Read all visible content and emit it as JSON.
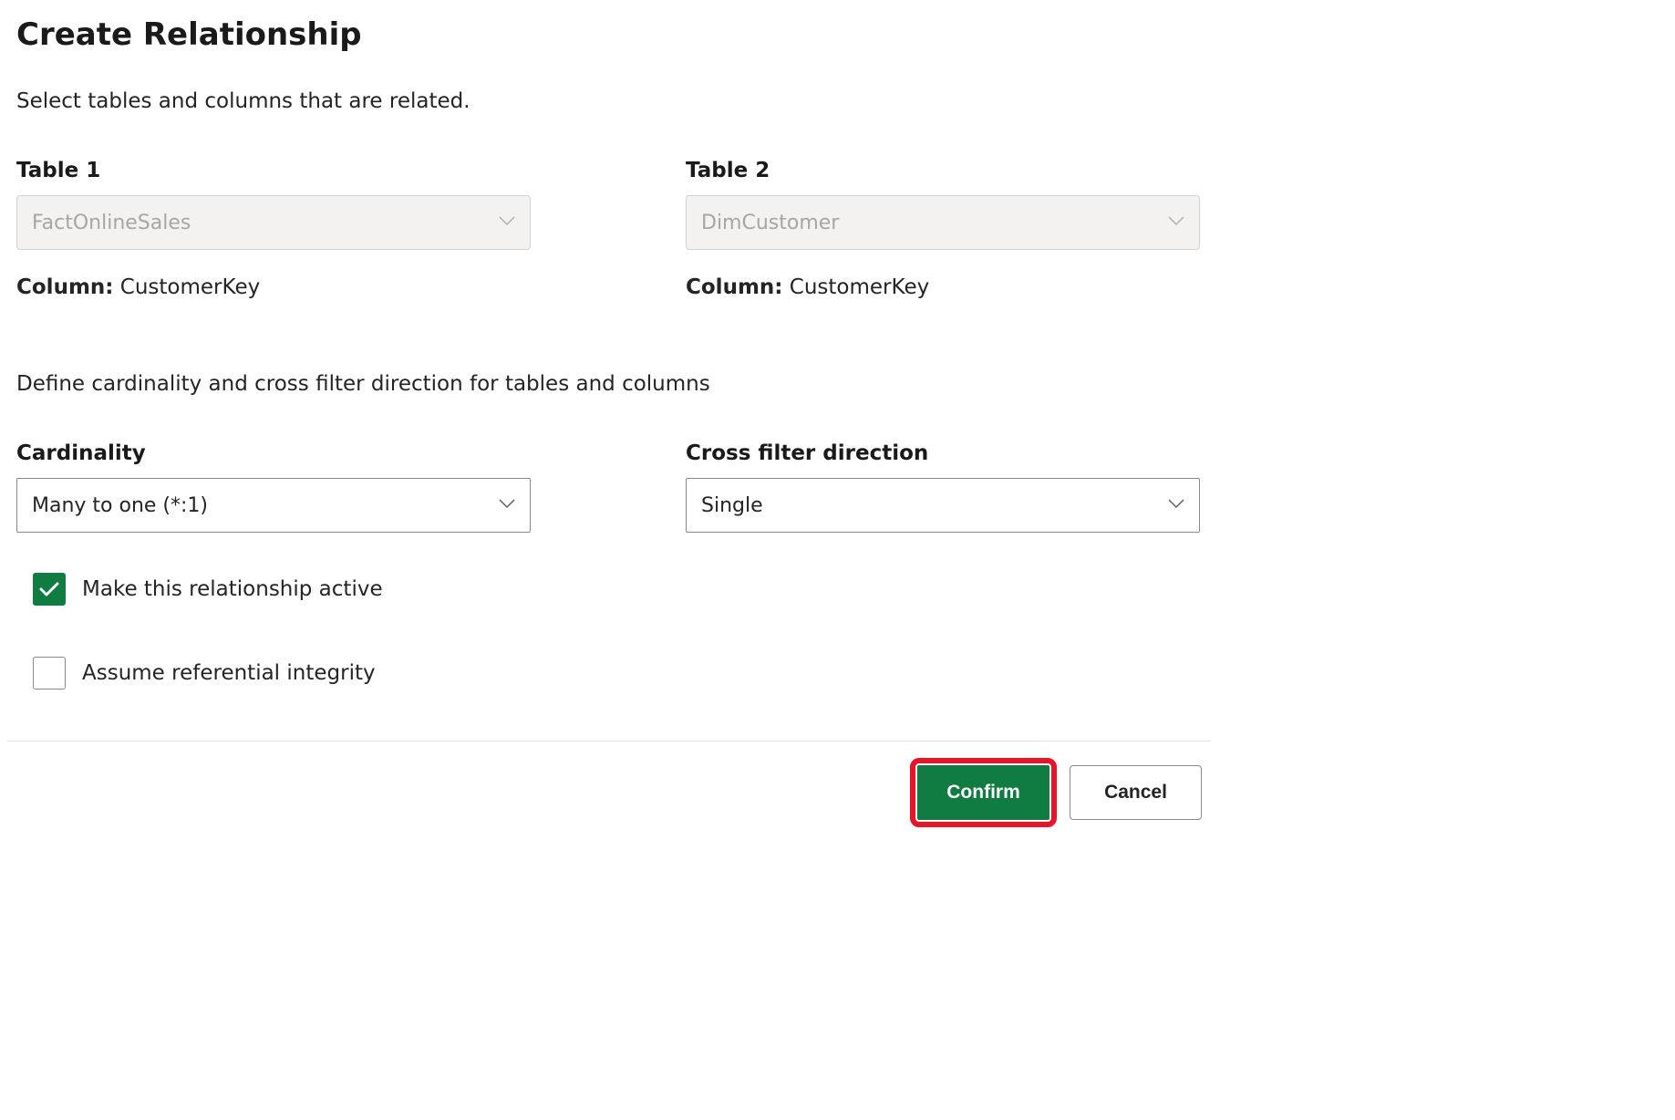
{
  "dialog": {
    "title": "Create Relationship",
    "subtitle": "Select tables and columns that are related.",
    "table1": {
      "label": "Table 1",
      "value": "FactOnlineSales",
      "column_label": "Column:",
      "column_value": "CustomerKey"
    },
    "table2": {
      "label": "Table 2",
      "value": "DimCustomer",
      "column_label": "Column:",
      "column_value": "CustomerKey"
    },
    "define_text": "Define cardinality and cross filter direction for tables and columns",
    "cardinality": {
      "label": "Cardinality",
      "value": "Many to one (*:1)"
    },
    "crossfilter": {
      "label": "Cross filter direction",
      "value": "Single"
    },
    "active_checkbox": {
      "label": "Make this relationship active",
      "checked": true
    },
    "integrity_checkbox": {
      "label": "Assume referential integrity",
      "checked": false
    },
    "buttons": {
      "confirm": "Confirm",
      "cancel": "Cancel"
    }
  }
}
